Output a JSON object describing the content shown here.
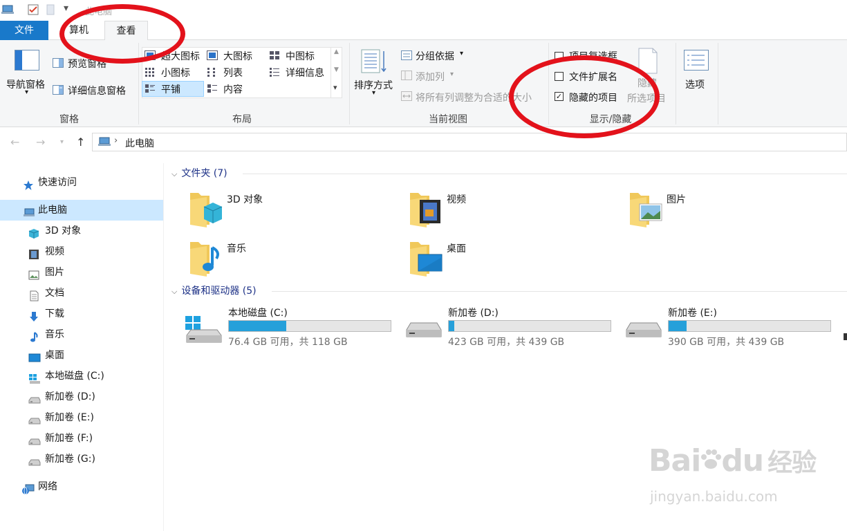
{
  "window": {
    "title": "此电脑"
  },
  "tabs": {
    "file": "文件",
    "computer": "算机",
    "view": "查看"
  },
  "ribbon": {
    "panes": {
      "nav_pane": "导航窗格",
      "preview_pane": "预览窗格",
      "details_pane": "详细信息窗格",
      "group_label": "窗格"
    },
    "layout": {
      "items": [
        "超大图标",
        "大图标",
        "中图标",
        "小图标",
        "列表",
        "详细信息",
        "平铺",
        "内容"
      ],
      "group_label": "布局"
    },
    "current_view": {
      "sort_by": "排序方式",
      "group_by": "分组依据",
      "add_columns": "添加列",
      "size_all_columns": "将所有列调整为合适的大小",
      "group_label": "当前视图"
    },
    "show_hide": {
      "item_checkboxes": "项目复选框",
      "file_extensions": "文件扩展名",
      "hidden_items": "隐藏的项目",
      "file_extensions_checked": false,
      "hidden_items_checked": true,
      "hide_selected_1": "隐藏",
      "hide_selected_2": "所选项目",
      "group_label": "显示/隐藏"
    },
    "options": "选项"
  },
  "address": {
    "path": "此电脑"
  },
  "sidebar": {
    "items": [
      {
        "label": "快速访问",
        "icon": "star-icon"
      },
      {
        "label": "此电脑",
        "icon": "computer-icon",
        "selected": true
      },
      {
        "label": "3D 对象",
        "icon": "3d-objects-icon"
      },
      {
        "label": "视频",
        "icon": "video-icon"
      },
      {
        "label": "图片",
        "icon": "pictures-icon"
      },
      {
        "label": "文档",
        "icon": "documents-icon"
      },
      {
        "label": "下载",
        "icon": "download-icon"
      },
      {
        "label": "音乐",
        "icon": "music-icon"
      },
      {
        "label": "桌面",
        "icon": "desktop-icon"
      },
      {
        "label": "本地磁盘 (C:)",
        "icon": "windows-drive-icon"
      },
      {
        "label": "新加卷 (D:)",
        "icon": "drive-icon"
      },
      {
        "label": "新加卷 (E:)",
        "icon": "drive-icon"
      },
      {
        "label": "新加卷 (F:)",
        "icon": "drive-icon"
      },
      {
        "label": "新加卷 (G:)",
        "icon": "drive-icon"
      },
      {
        "label": "网络",
        "icon": "network-icon"
      }
    ]
  },
  "main": {
    "folders_header": "文件夹 (7)",
    "folders": [
      {
        "label": "3D 对象",
        "icon": "3d-objects-folder-icon"
      },
      {
        "label": "视频",
        "icon": "video-folder-icon"
      },
      {
        "label": "图片",
        "icon": "pictures-folder-icon"
      },
      {
        "label": "音乐",
        "icon": "music-folder-icon"
      },
      {
        "label": "桌面",
        "icon": "desktop-folder-icon"
      }
    ],
    "drives_header": "设备和驱动器 (5)",
    "drives": [
      {
        "label": "本地磁盘 (C:)",
        "free": "76.4 GB 可用，共 118 GB",
        "used_fraction": 0.353
      },
      {
        "label": "新加卷 (D:)",
        "free": "423 GB 可用，共 439 GB",
        "used_fraction": 0.036
      },
      {
        "label": "新加卷 (E:)",
        "free": "390 GB 可用，共 439 GB",
        "used_fraction": 0.112
      }
    ]
  },
  "watermark": {
    "line1": "Bai",
    "line2": "du",
    "line3": "经验",
    "line4": "jingyan.baidu.com"
  },
  "colors": {
    "accent": "#1979ca",
    "drive_fill": "#26a0da",
    "selection": "#cce8ff",
    "annotation": "#e3121b"
  }
}
